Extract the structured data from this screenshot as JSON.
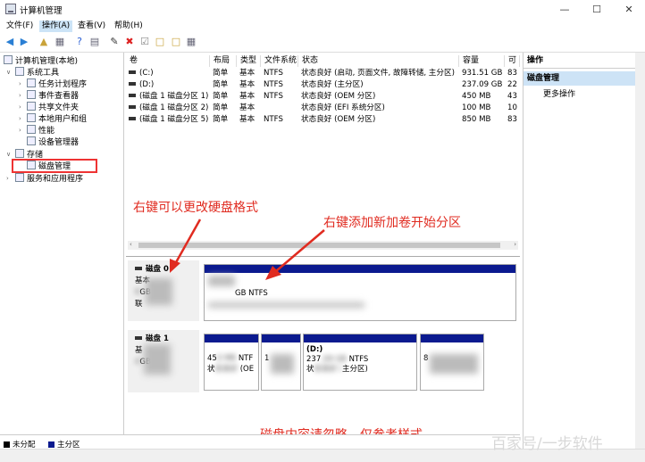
{
  "window": {
    "title": "计算机管理"
  },
  "menu": [
    "文件(F)",
    "操作(A)",
    "查看(V)",
    "帮助(H)"
  ],
  "tree": {
    "root": "计算机管理(本地)",
    "system_tools": "系统工具",
    "task_scheduler": "任务计划程序",
    "event_viewer": "事件查看器",
    "shared_folders": "共享文件夹",
    "local_users": "本地用户和组",
    "performance": "性能",
    "device_manager": "设备管理器",
    "storage": "存储",
    "disk_management": "磁盘管理",
    "services_apps": "服务和应用程序"
  },
  "grid": {
    "headers": [
      "卷",
      "布局",
      "类型",
      "文件系统",
      "状态",
      "容量",
      "可"
    ],
    "rows": [
      {
        "vol": "(C:)",
        "layout": "简单",
        "type": "基本",
        "fs": "NTFS",
        "status": "状态良好 (启动, 页面文件, 故障转储, 主分区)",
        "cap": "931.51 GB",
        "free": "83"
      },
      {
        "vol": "(D:)",
        "layout": "简单",
        "type": "基本",
        "fs": "NTFS",
        "status": "状态良好 (主分区)",
        "cap": "237.09 GB",
        "free": "22"
      },
      {
        "vol": "(磁盘 1 磁盘分区 1)",
        "layout": "简单",
        "type": "基本",
        "fs": "NTFS",
        "status": "状态良好 (OEM 分区)",
        "cap": "450 MB",
        "free": "43"
      },
      {
        "vol": "(磁盘 1 磁盘分区 2)",
        "layout": "简单",
        "type": "基本",
        "fs": "",
        "status": "状态良好 (EFI 系统分区)",
        "cap": "100 MB",
        "free": "10"
      },
      {
        "vol": "(磁盘 1 磁盘分区 5)",
        "layout": "简单",
        "type": "基本",
        "fs": "NTFS",
        "status": "状态良好 (OEM 分区)",
        "cap": "850 MB",
        "free": "83"
      }
    ]
  },
  "disks": {
    "disk0": {
      "name": "磁盘 0",
      "type": "基本",
      "size": "GB",
      "status": "联",
      "part_fs": "GB NTFS"
    },
    "disk1": {
      "name": "磁盘 1",
      "type": "基",
      "size": "GB",
      "p1_line1": "45",
      "p1_fs": "NTF",
      "p1_status": "状",
      "p1_oem": "(OE",
      "p2_line1": "1",
      "p3_label": "(D:)",
      "p3_line1": "237",
      "p3_fs": "NTFS",
      "p3_status": "状",
      "p3_tail": "主分区)",
      "p4_line1": "8"
    }
  },
  "legend": {
    "unallocated": "未分配",
    "primary": "主分区",
    "unalloc_color": "#000000",
    "primary_color": "#0b1a8f"
  },
  "actions": {
    "header": "操作",
    "section": "磁盘管理",
    "more": "更多操作"
  },
  "annotations": {
    "format": "右键可以更改硬盘格式",
    "new_volume": "右键添加新加卷开始分区",
    "ignore": "磁盘内容请忽略，仅参考样式"
  },
  "watermark": "百家号/一步软件",
  "colors": {
    "annotation": "#e02b20",
    "partition_bar": "#0b1a8f",
    "selection": "#cde3f6"
  }
}
